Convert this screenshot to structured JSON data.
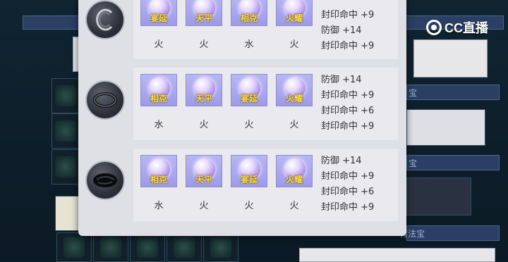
{
  "watermark": {
    "text": "CC直播"
  },
  "background": {
    "labels": [
      "宝",
      "宝",
      "有法宝"
    ]
  },
  "rows": [
    {
      "slot": "ring-c",
      "gems": [
        {
          "name": "宴延",
          "element": "火"
        },
        {
          "name": "天平",
          "element": "火"
        },
        {
          "name": "相克",
          "element": "水"
        },
        {
          "name": "火耀",
          "element": "火"
        }
      ],
      "stats": [
        "封印命中 +9",
        "防御 +14",
        "封印命中 +9"
      ]
    },
    {
      "slot": "ring-o",
      "gems": [
        {
          "name": "相克",
          "element": "水"
        },
        {
          "name": "天平",
          "element": "火"
        },
        {
          "name": "宴延",
          "element": "火"
        },
        {
          "name": "火耀",
          "element": "火"
        }
      ],
      "stats": [
        "防御 +14",
        "封印命中 +9",
        "封印命中 +6",
        "封印命中 +9"
      ]
    },
    {
      "slot": "ring-disc",
      "gems": [
        {
          "name": "相克",
          "element": "水"
        },
        {
          "name": "天平",
          "element": "火"
        },
        {
          "name": "宴延",
          "element": "火"
        },
        {
          "name": "火耀",
          "element": "火"
        }
      ],
      "stats": [
        "防御 +14",
        "封印命中 +9",
        "封印命中 +6",
        "封印命中 +9"
      ]
    }
  ]
}
